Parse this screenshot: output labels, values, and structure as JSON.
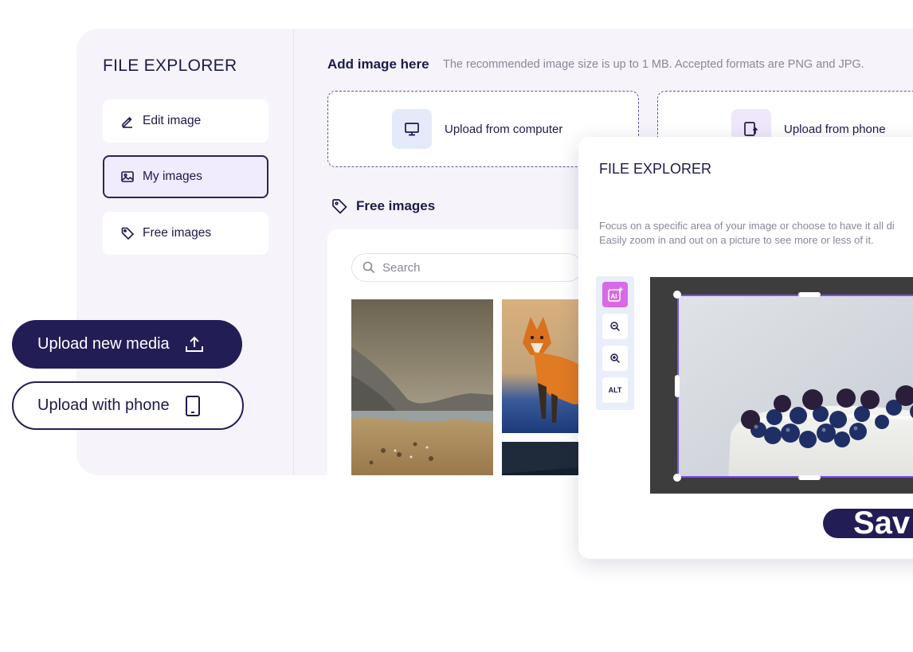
{
  "sidebar": {
    "title": "FILE EXPLORER",
    "items": [
      {
        "label": "Edit image",
        "icon": "pencil-icon"
      },
      {
        "label": "My images",
        "icon": "image-icon",
        "active": true
      },
      {
        "label": "Free images",
        "icon": "tag-icon"
      }
    ]
  },
  "main": {
    "add_title": "Add image here",
    "add_hint": "The recommended image size is up to 1 MB. Accepted formats are PNG and JPG.",
    "upload_computer": "Upload from computer",
    "upload_phone": "Upload from phone",
    "free_images_title": "Free images",
    "search_placeholder": "Search"
  },
  "floating": {
    "upload_new_media": "Upload new media",
    "upload_with_phone": "Upload with phone"
  },
  "overlay": {
    "title": "FILE EXPLORER",
    "desc_line1": "Focus on a specific area of your image or choose to have it all di",
    "desc_line2": "Easily zoom in and out on a picture to see more or less of it.",
    "tools": [
      "AI",
      "zoom-out-icon",
      "zoom-in-icon",
      "ALT"
    ],
    "save_label": "Sav"
  },
  "colors": {
    "primary": "#231d56",
    "accent_purple": "#7e4fe6",
    "panel_bg": "#f6f4fa",
    "active_bg": "#f1ecfd"
  }
}
